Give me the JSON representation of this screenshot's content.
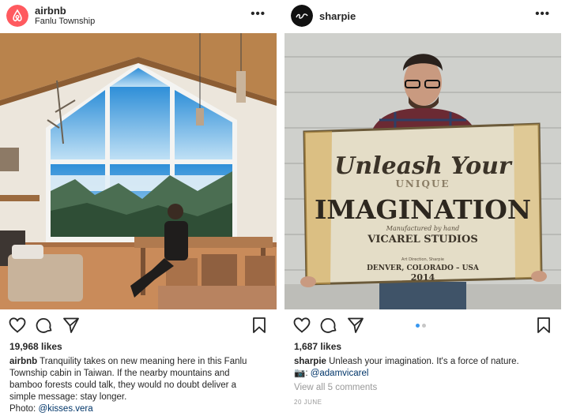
{
  "left_post": {
    "username": "airbnb",
    "location": "Fanlu Township",
    "more": "•••",
    "likes": "19,968 likes",
    "caption_user": "airbnb",
    "caption_lines": [
      "Tranquility takes on new meaning here in this Fanlu",
      "Township cabin in Taiwan. If the nearby mountains and",
      "bamboo forests could talk, they would no doubt deliver a",
      "simple message: stay longer."
    ],
    "credit_prefix": "Photo: ",
    "credit_mention": "@kisses.vera",
    "colors": {
      "avatar": "#ff5a5f"
    }
  },
  "right_post": {
    "username": "sharpie",
    "more": "•••",
    "likes": "1,687 likes",
    "caption_user": "sharpie",
    "caption_text": "Unleash your imagination. It's a force of nature.",
    "credit_prefix": "📷: ",
    "credit_mention": "@adamvicarel",
    "view_comments": "View all 5 comments",
    "date": "20 JUNE",
    "image_text": {
      "line1": "Unleash Your",
      "line2": "UNIQUE",
      "line3": "IMAGINATION",
      "line4": "Manufactured by hand",
      "line5": "VICAREL STUDIOS",
      "line6": "Art Direction, Sharpie",
      "line7": "DENVER, COLORADO – USA",
      "line8": "2014"
    },
    "colors": {
      "dot_active": "#3897f0",
      "dot_inactive": "#c7c7c7"
    }
  },
  "icons": {
    "like": "heart-icon",
    "comment": "comment-icon",
    "share": "paper-plane-icon",
    "save": "bookmark-icon"
  }
}
